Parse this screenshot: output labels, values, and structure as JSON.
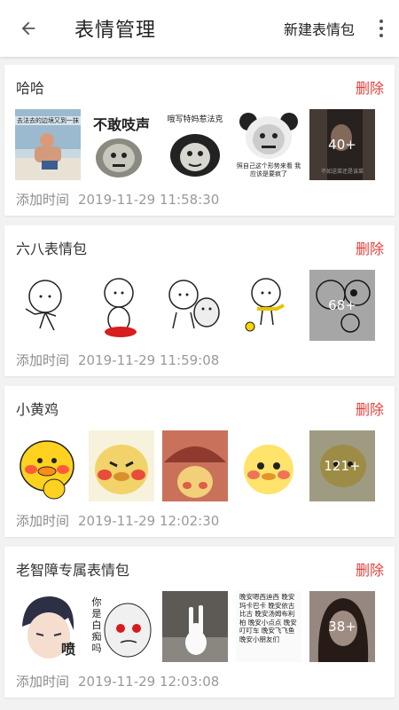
{
  "appbar": {
    "title": "表情管理",
    "action_label": "新建表情包"
  },
  "labels": {
    "delete": "删除",
    "added_time": "添加时间"
  },
  "groups": [
    {
      "name": "哈哈",
      "time": "2019-11-29 11:58:30",
      "more_count": "40+",
      "thumb_texts": [
        "去法去的边境又到一抹",
        "不敢吱声",
        "哦写特妈惹法克",
        "照自己这个形势来看 我应该是要疯了",
        "不如送菜还是该菜"
      ]
    },
    {
      "name": "六八表情包",
      "time": "2019-11-29 11:59:08",
      "more_count": "68+"
    },
    {
      "name": "小黄鸡",
      "time": "2019-11-29 12:02:30",
      "more_count": "121+"
    },
    {
      "name": "老智障专属表情包",
      "time": "2019-11-29 12:03:08",
      "more_count": "38+",
      "thumb_texts": [
        "喷",
        "你是白痴吗",
        "晚安嗯西迪西 晚安玛卡巴卡 晚安依古比古 晚安汤姆布利柏 晚安小点点 晚安叮叮车 晚安飞飞鱼 晚安小朋友们"
      ]
    }
  ]
}
